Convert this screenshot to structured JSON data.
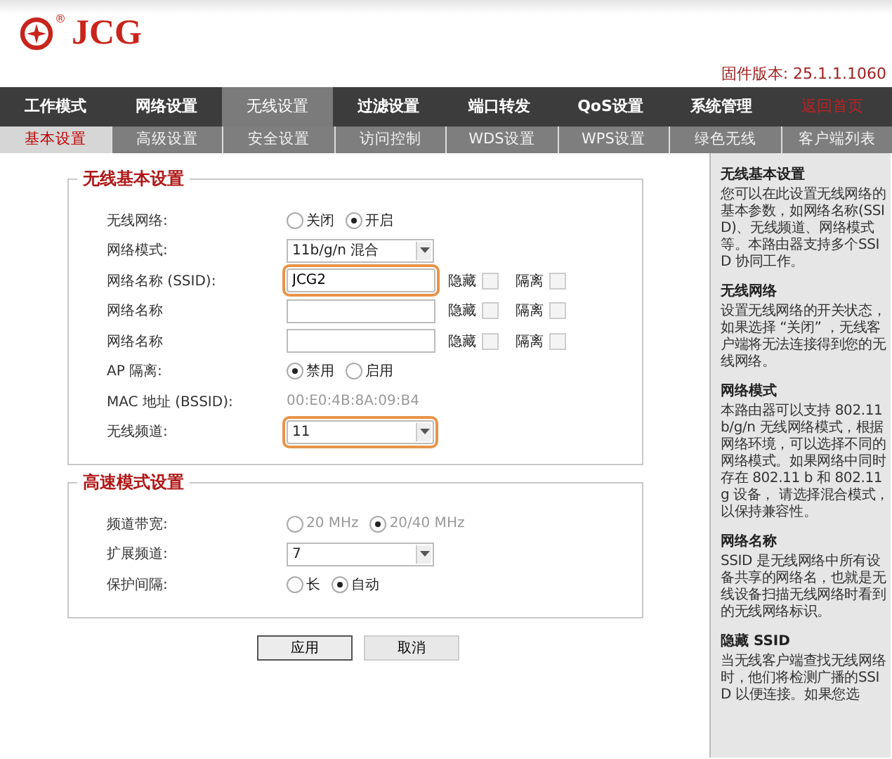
{
  "logo": {
    "text": "JCG",
    "mark": "®"
  },
  "firmware": "固件版本: 25.1.1.1060",
  "nav": [
    {
      "label": "工作模式",
      "kind": "tab",
      "selected": false
    },
    {
      "label": "网络设置",
      "kind": "tab",
      "selected": false
    },
    {
      "label": "无线设置",
      "kind": "tab",
      "selected": true
    },
    {
      "label": "过滤设置",
      "kind": "tab",
      "selected": false
    },
    {
      "label": "端口转发",
      "kind": "tab",
      "selected": false
    },
    {
      "label": "QoS设置",
      "kind": "tab",
      "selected": false
    },
    {
      "label": "系统管理",
      "kind": "tab",
      "selected": false
    },
    {
      "label": "返回首页",
      "kind": "link",
      "selected": false
    }
  ],
  "subnav": [
    {
      "label": "基本设置",
      "selected": true
    },
    {
      "label": "高级设置",
      "selected": false
    },
    {
      "label": "安全设置",
      "selected": false
    },
    {
      "label": "访问控制",
      "selected": false
    },
    {
      "label": "WDS设置",
      "selected": false
    },
    {
      "label": "WPS设置",
      "selected": false
    },
    {
      "label": "绿色无线",
      "selected": false
    },
    {
      "label": "客户端列表",
      "selected": false
    }
  ],
  "sections": [
    {
      "title": "无线基本设置",
      "rows": [
        {
          "kind": "radio",
          "label": "无线网络:",
          "disabled": false,
          "options": [
            {
              "label": "关闭",
              "selected": false
            },
            {
              "label": "开启",
              "selected": true
            }
          ]
        },
        {
          "kind": "select",
          "label": "网络模式:",
          "value": "11b/g/n 混合",
          "highlighted": false
        },
        {
          "kind": "ssid",
          "label": "网络名称 (SSID):",
          "value": "JCG2",
          "highlighted": true,
          "checks": [
            {
              "label": "隐藏",
              "checked": false
            },
            {
              "label": "隔离",
              "checked": false
            }
          ]
        },
        {
          "kind": "ssid",
          "label": "网络名称",
          "highlighted": false,
          "checks": [
            {
              "label": "隐藏",
              "checked": false
            },
            {
              "label": "隔离",
              "checked": false
            }
          ]
        },
        {
          "kind": "ssid",
          "label": "网络名称",
          "highlighted": false,
          "checks": [
            {
              "label": "隐藏",
              "checked": false
            },
            {
              "label": "隔离",
              "checked": false
            }
          ]
        },
        {
          "kind": "radio",
          "label": "AP 隔离:",
          "disabled": false,
          "options": [
            {
              "label": "禁用",
              "selected": true
            },
            {
              "label": "启用",
              "selected": false
            }
          ]
        },
        {
          "kind": "info",
          "label": "MAC 地址 (BSSID):",
          "value": "00:E0:4B:8A:09:B4"
        },
        {
          "kind": "select",
          "label": "无线频道:",
          "value": "11",
          "highlighted": true
        }
      ]
    },
    {
      "title": "高速模式设置",
      "rows": [
        {
          "kind": "radio",
          "label": "频道带宽:",
          "disabled": true,
          "options": [
            {
              "label": "20 MHz",
              "selected": false
            },
            {
              "label": "20/40 MHz",
              "selected": true
            }
          ]
        },
        {
          "kind": "select",
          "label": "扩展频道:",
          "value": "7",
          "highlighted": false
        },
        {
          "kind": "radio",
          "label": "保护间隔:",
          "disabled": false,
          "options": [
            {
              "label": "长",
              "selected": false
            },
            {
              "label": "自动",
              "selected": true
            }
          ]
        }
      ]
    }
  ],
  "buttons": [
    {
      "label": "应用",
      "kind": "primary"
    },
    {
      "label": "取消",
      "kind": "secondary"
    }
  ],
  "help": [
    {
      "title": "无线基本设置",
      "text": "您可以在此设置无线网络的基本参数，如网络名称(SSID)、无线频道、网络模式等。本路由器支持多个SSID 协同工作。"
    },
    {
      "title": "无线网络",
      "text": "设置无线网络的开关状态，如果选择 “关闭” ，无线客户端将无法连接得到您的无线网络。"
    },
    {
      "title": "网络模式",
      "text": "本路由器可以支持 802.11 b/g/n 无线网络模式，根据网络环境，可以选择不同的网络模式。如果网络中同时存在 802.11 b 和 802.11 g 设备， 请选择混合模式，以保持兼容性。"
    },
    {
      "title": "网络名称",
      "text": "SSID 是无线网络中所有设备共享的网络名，也就是无线设备扫描无线网络时看到的无线网络标识。"
    },
    {
      "title": "隐藏 SSID",
      "text": "当无线客户端查找无线网络时，他们将检测广播的SSID 以便连接。如果您选"
    }
  ]
}
